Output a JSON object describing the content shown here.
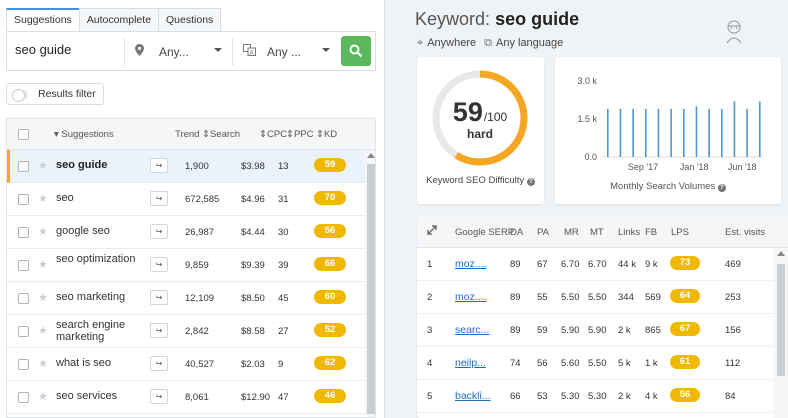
{
  "tabs": [
    {
      "label": "Suggestions"
    },
    {
      "label": "Autocomplete"
    },
    {
      "label": "Questions"
    }
  ],
  "search": {
    "value": "seo guide",
    "location": "Any...",
    "language": "Any ..."
  },
  "filter": {
    "label": "Results filter"
  },
  "table": {
    "headers": {
      "suggestions": "Suggestions",
      "trend": "Trend",
      "search": "Search",
      "cpc": "CPC",
      "ppc": "PPC",
      "kd": "KD"
    },
    "rows": [
      {
        "keyword": "seo guide",
        "search": "1,900",
        "cpc": "$3.98",
        "ppc": "13",
        "kd": "59",
        "kd_color": "#f0b800"
      },
      {
        "keyword": "seo",
        "search": "672,585",
        "cpc": "$4.96",
        "ppc": "31",
        "kd": "70",
        "kd_color": "#f0b800"
      },
      {
        "keyword": "google seo",
        "search": "26,987",
        "cpc": "$4.44",
        "ppc": "30",
        "kd": "56",
        "kd_color": "#f0b800"
      },
      {
        "keyword": "seo optimization",
        "search": "9,859",
        "cpc": "$9.39",
        "ppc": "39",
        "kd": "66",
        "kd_color": "#f0b800"
      },
      {
        "keyword": "seo marketing",
        "search": "12,109",
        "cpc": "$8.50",
        "ppc": "45",
        "kd": "60",
        "kd_color": "#f0b800"
      },
      {
        "keyword": "search engine marketing",
        "search": "2,842",
        "cpc": "$8.58",
        "ppc": "27",
        "kd": "52",
        "kd_color": "#f0b800"
      },
      {
        "keyword": "what is seo",
        "search": "40,527",
        "cpc": "$2.03",
        "ppc": "9",
        "kd": "62",
        "kd_color": "#f0b800"
      },
      {
        "keyword": "seo services",
        "search": "8,061",
        "cpc": "$12.90",
        "ppc": "47",
        "kd": "46",
        "kd_color": "#f0b800"
      }
    ]
  },
  "keyword": {
    "prefix": "Keyword:",
    "value": "seo guide",
    "location": "Anywhere",
    "language": "Any language"
  },
  "kd": {
    "score": "59",
    "max": "/100",
    "level": "hard",
    "label": "Keyword SEO Difficulty",
    "value": 59,
    "color": "#f5a623"
  },
  "volumes": {
    "label": "Monthly Search Volumes"
  },
  "chart_data": {
    "type": "bar",
    "y_ticks": [
      "3.0 k",
      "1.5 k",
      "0.0"
    ],
    "x_ticks": [
      "Sep '17",
      "Jan '18",
      "Jun '18"
    ],
    "ylim": [
      0,
      3000
    ],
    "values": [
      1900,
      1900,
      1900,
      1900,
      1900,
      1900,
      1900,
      2000,
      1900,
      1900,
      2200,
      1900,
      2200
    ],
    "color": "#4a9ad6"
  },
  "serp": {
    "headers": {
      "serp": "Google SERP",
      "da": "DA",
      "pa": "PA",
      "mr": "MR",
      "mt": "MT",
      "links": "Links",
      "fb": "FB",
      "lps": "LPS",
      "visits": "Est. visits"
    },
    "rows": [
      {
        "rank": "1",
        "url": "moz....",
        "da": "89",
        "pa": "67",
        "mr": "6.70",
        "mt": "6.70",
        "links": "44 k",
        "fb": "9 k",
        "lps": "73",
        "visits": "469",
        "color": "#f0b800"
      },
      {
        "rank": "2",
        "url": "moz....",
        "da": "89",
        "pa": "55",
        "mr": "5.50",
        "mt": "5.50",
        "links": "344",
        "fb": "569",
        "lps": "64",
        "visits": "253",
        "color": "#f0b800"
      },
      {
        "rank": "3",
        "url": "searc...",
        "da": "89",
        "pa": "59",
        "mr": "5.90",
        "mt": "5.90",
        "links": "2 k",
        "fb": "865",
        "lps": "67",
        "visits": "156",
        "color": "#f0b800"
      },
      {
        "rank": "4",
        "url": "neilp...",
        "da": "74",
        "pa": "56",
        "mr": "5.60",
        "mt": "5.50",
        "links": "5 k",
        "fb": "1 k",
        "lps": "61",
        "visits": "112",
        "color": "#f0b800"
      },
      {
        "rank": "5",
        "url": "backli...",
        "da": "66",
        "pa": "53",
        "mr": "5.30",
        "mt": "5.30",
        "links": "2 k",
        "fb": "4 k",
        "lps": "56",
        "visits": "84",
        "color": "#f0b800"
      }
    ]
  }
}
